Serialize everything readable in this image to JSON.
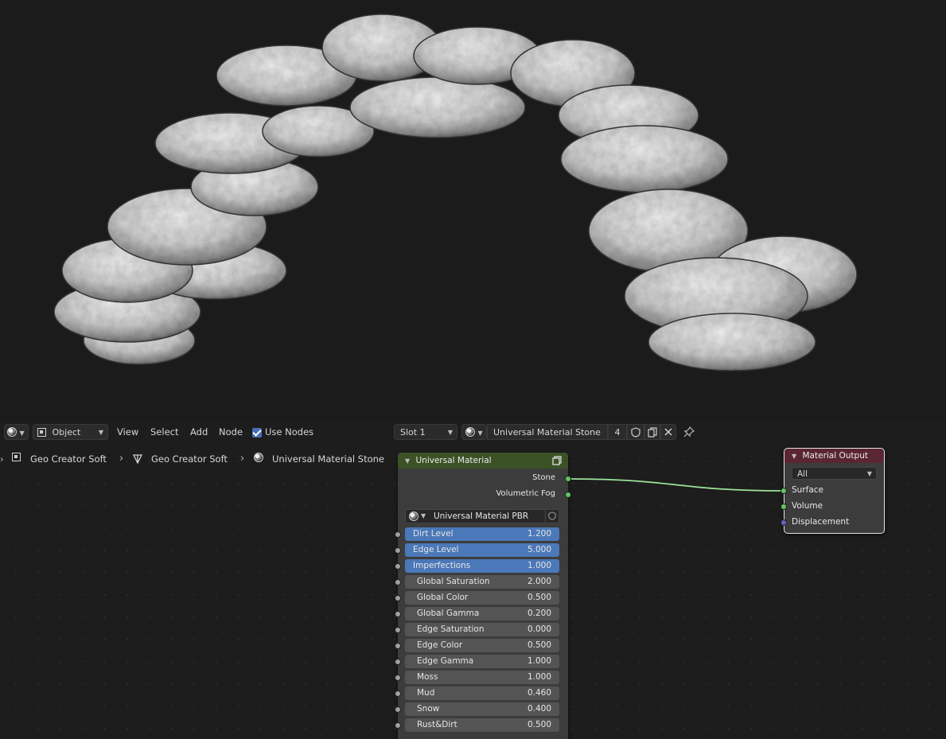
{
  "header": {
    "mode": "Object",
    "menus": [
      "View",
      "Select",
      "Add",
      "Node"
    ],
    "use_nodes_label": "Use Nodes",
    "slot": "Slot 1",
    "material_name": "Universal Material Stone",
    "user_count": "4"
  },
  "breadcrumb": {
    "object": "Geo Creator Soft",
    "mesh": "Geo Creator Soft",
    "material": "Universal Material Stone"
  },
  "group_node": {
    "title": "Universal Material",
    "outputs": [
      "Stone",
      "Volumetric Fog"
    ],
    "group_name": "Universal Material PBR",
    "inputs": [
      {
        "label": "Dirt Level",
        "value": "1.200"
      },
      {
        "label": "Edge Level",
        "value": "5.000"
      },
      {
        "label": "Imperfections",
        "value": "1.000"
      },
      {
        "label": "Global Saturation",
        "value": "2.000"
      },
      {
        "label": "Global Color",
        "value": "0.500"
      },
      {
        "label": "Global Gamma",
        "value": "0.200"
      },
      {
        "label": "Edge Saturation",
        "value": "0.000"
      },
      {
        "label": "Edge Color",
        "value": "0.500"
      },
      {
        "label": "Edge Gamma",
        "value": "1.000"
      },
      {
        "label": "Moss",
        "value": "1.000"
      },
      {
        "label": "Mud",
        "value": "0.460"
      },
      {
        "label": "Snow",
        "value": "0.400"
      },
      {
        "label": "Rust&Dirt",
        "value": "0.500"
      }
    ]
  },
  "output_node": {
    "title": "Material Output",
    "target": "All",
    "inputs": [
      "Surface",
      "Volume",
      "Displacement"
    ]
  },
  "colors": {
    "group_header": "#3b5226",
    "output_header": "#5a2534",
    "field_active": "#4b78b8",
    "socket_shader": "#63c763",
    "socket_value": "#a1a1a1",
    "socket_vector": "#6363c7"
  }
}
